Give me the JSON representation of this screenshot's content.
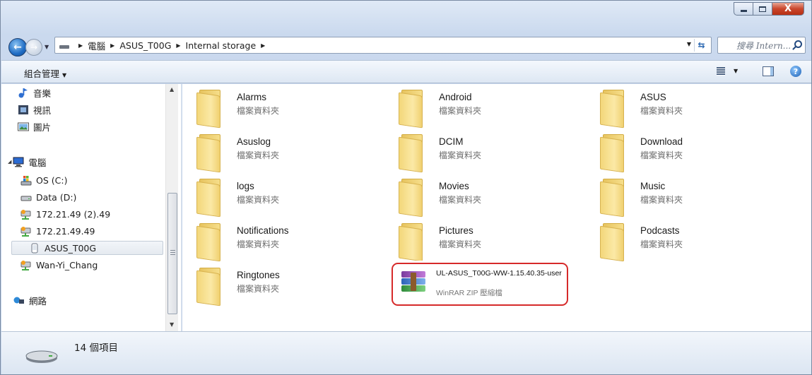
{
  "window": {
    "minimize_label": "—",
    "maximize_label": "□",
    "close_label": "X"
  },
  "address": {
    "crumbs": [
      "電腦",
      "ASUS_T00G",
      "Internal storage"
    ],
    "search_placeholder": "搜尋 Intern..."
  },
  "toolbar": {
    "organize_label": "組合管理",
    "help_label": "?"
  },
  "sidebar": {
    "items": [
      {
        "label": "音樂",
        "icon": "music-icon"
      },
      {
        "label": "視訊",
        "icon": "video-icon"
      },
      {
        "label": "圖片",
        "icon": "pictures-icon"
      },
      {
        "label": "電腦",
        "icon": "computer-icon"
      },
      {
        "label": "OS (C:)",
        "icon": "drive-os-icon"
      },
      {
        "label": "Data (D:)",
        "icon": "drive-icon"
      },
      {
        "label": "172.21.49 (2).49",
        "icon": "network-drive-icon"
      },
      {
        "label": "172.21.49.49",
        "icon": "network-drive-icon"
      },
      {
        "label": "ASUS_T00G",
        "icon": "phone-icon"
      },
      {
        "label": "Wan-Yi_Chang",
        "icon": "network-drive-icon"
      },
      {
        "label": "網路",
        "icon": "network-icon"
      }
    ]
  },
  "files": [
    {
      "name": "Alarms",
      "type": "檔案資料夾"
    },
    {
      "name": "Android",
      "type": "檔案資料夾"
    },
    {
      "name": "ASUS",
      "type": "檔案資料夾"
    },
    {
      "name": "Asuslog",
      "type": "檔案資料夾"
    },
    {
      "name": "DCIM",
      "type": "檔案資料夾"
    },
    {
      "name": "Download",
      "type": "檔案資料夾"
    },
    {
      "name": "logs",
      "type": "檔案資料夾"
    },
    {
      "name": "Movies",
      "type": "檔案資料夾"
    },
    {
      "name": "Music",
      "type": "檔案資料夾"
    },
    {
      "name": "Notifications",
      "type": "檔案資料夾"
    },
    {
      "name": "Pictures",
      "type": "檔案資料夾"
    },
    {
      "name": "Podcasts",
      "type": "檔案資料夾"
    },
    {
      "name": "Ringtones",
      "type": "檔案資料夾"
    }
  ],
  "archive": {
    "name": "UL-ASUS_T00G-WW-1.15.40.35-user",
    "type": "WinRAR ZIP 壓縮檔"
  },
  "status": {
    "count": "14 個項目"
  },
  "colors": {
    "highlight_ring": "#d62a2a",
    "folder": "#f3d77a"
  }
}
